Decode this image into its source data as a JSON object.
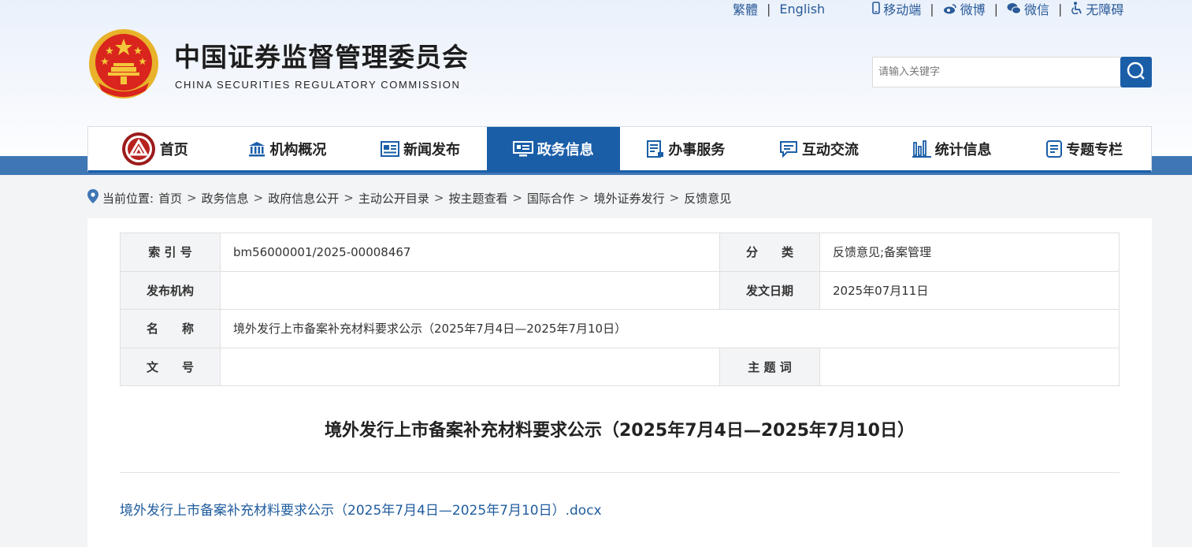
{
  "top_links": {
    "traditional": "繁體",
    "english": "English",
    "mobile": "移动端",
    "weibo": "微博",
    "wechat": "微信",
    "accessibility": "无障碍",
    "separator": "|"
  },
  "site": {
    "title_cn": "中国证券监督管理委员会",
    "title_en": "CHINA SECURITIES REGULATORY COMMISSION"
  },
  "search": {
    "placeholder": "请输入关键字"
  },
  "nav": {
    "items": [
      {
        "label": "首页",
        "icon": "emblem-icon"
      },
      {
        "label": "机构概况",
        "icon": "building-icon"
      },
      {
        "label": "新闻发布",
        "icon": "newspaper-icon"
      },
      {
        "label": "政务信息",
        "icon": "monitor-icon"
      },
      {
        "label": "办事服务",
        "icon": "document-icon"
      },
      {
        "label": "互动交流",
        "icon": "chat-icon"
      },
      {
        "label": "统计信息",
        "icon": "bar-chart-icon"
      },
      {
        "label": "专题专栏",
        "icon": "list-icon"
      }
    ],
    "active_index": 3
  },
  "breadcrumb": {
    "prefix": "当前位置:",
    "items": [
      "首页",
      "政务信息",
      "政府信息公开",
      "主动公开目录",
      "按主题查看",
      "国际合作",
      "境外证券发行",
      "反馈意见"
    ]
  },
  "meta": {
    "index_label": "索 引 号",
    "index_value": "bm56000001/2025-00008467",
    "category_label": "分　　类",
    "category_value": "反馈意见;备案管理",
    "publisher_label": "发布机构",
    "publisher_value": "",
    "date_label": "发文日期",
    "date_value": "2025年07月11日",
    "name_label": "名　　称",
    "name_value": "境外发行上市备案补充材料要求公示（2025年7月4日—2025年7月10日）",
    "docno_label": "文　　号",
    "docno_value": "",
    "subject_label": "主 题 词",
    "subject_value": ""
  },
  "document": {
    "title": "境外发行上市备案补充材料要求公示（2025年7月4日—2025年7月10日）",
    "attachment": "境外发行上市备案补充材料要求公示（2025年7月4日—2025年7月10日）.docx"
  },
  "colors": {
    "brand_blue": "#1a5ea8",
    "stripe_blue": "#3f77b5",
    "link_blue": "#1f5c9e"
  }
}
